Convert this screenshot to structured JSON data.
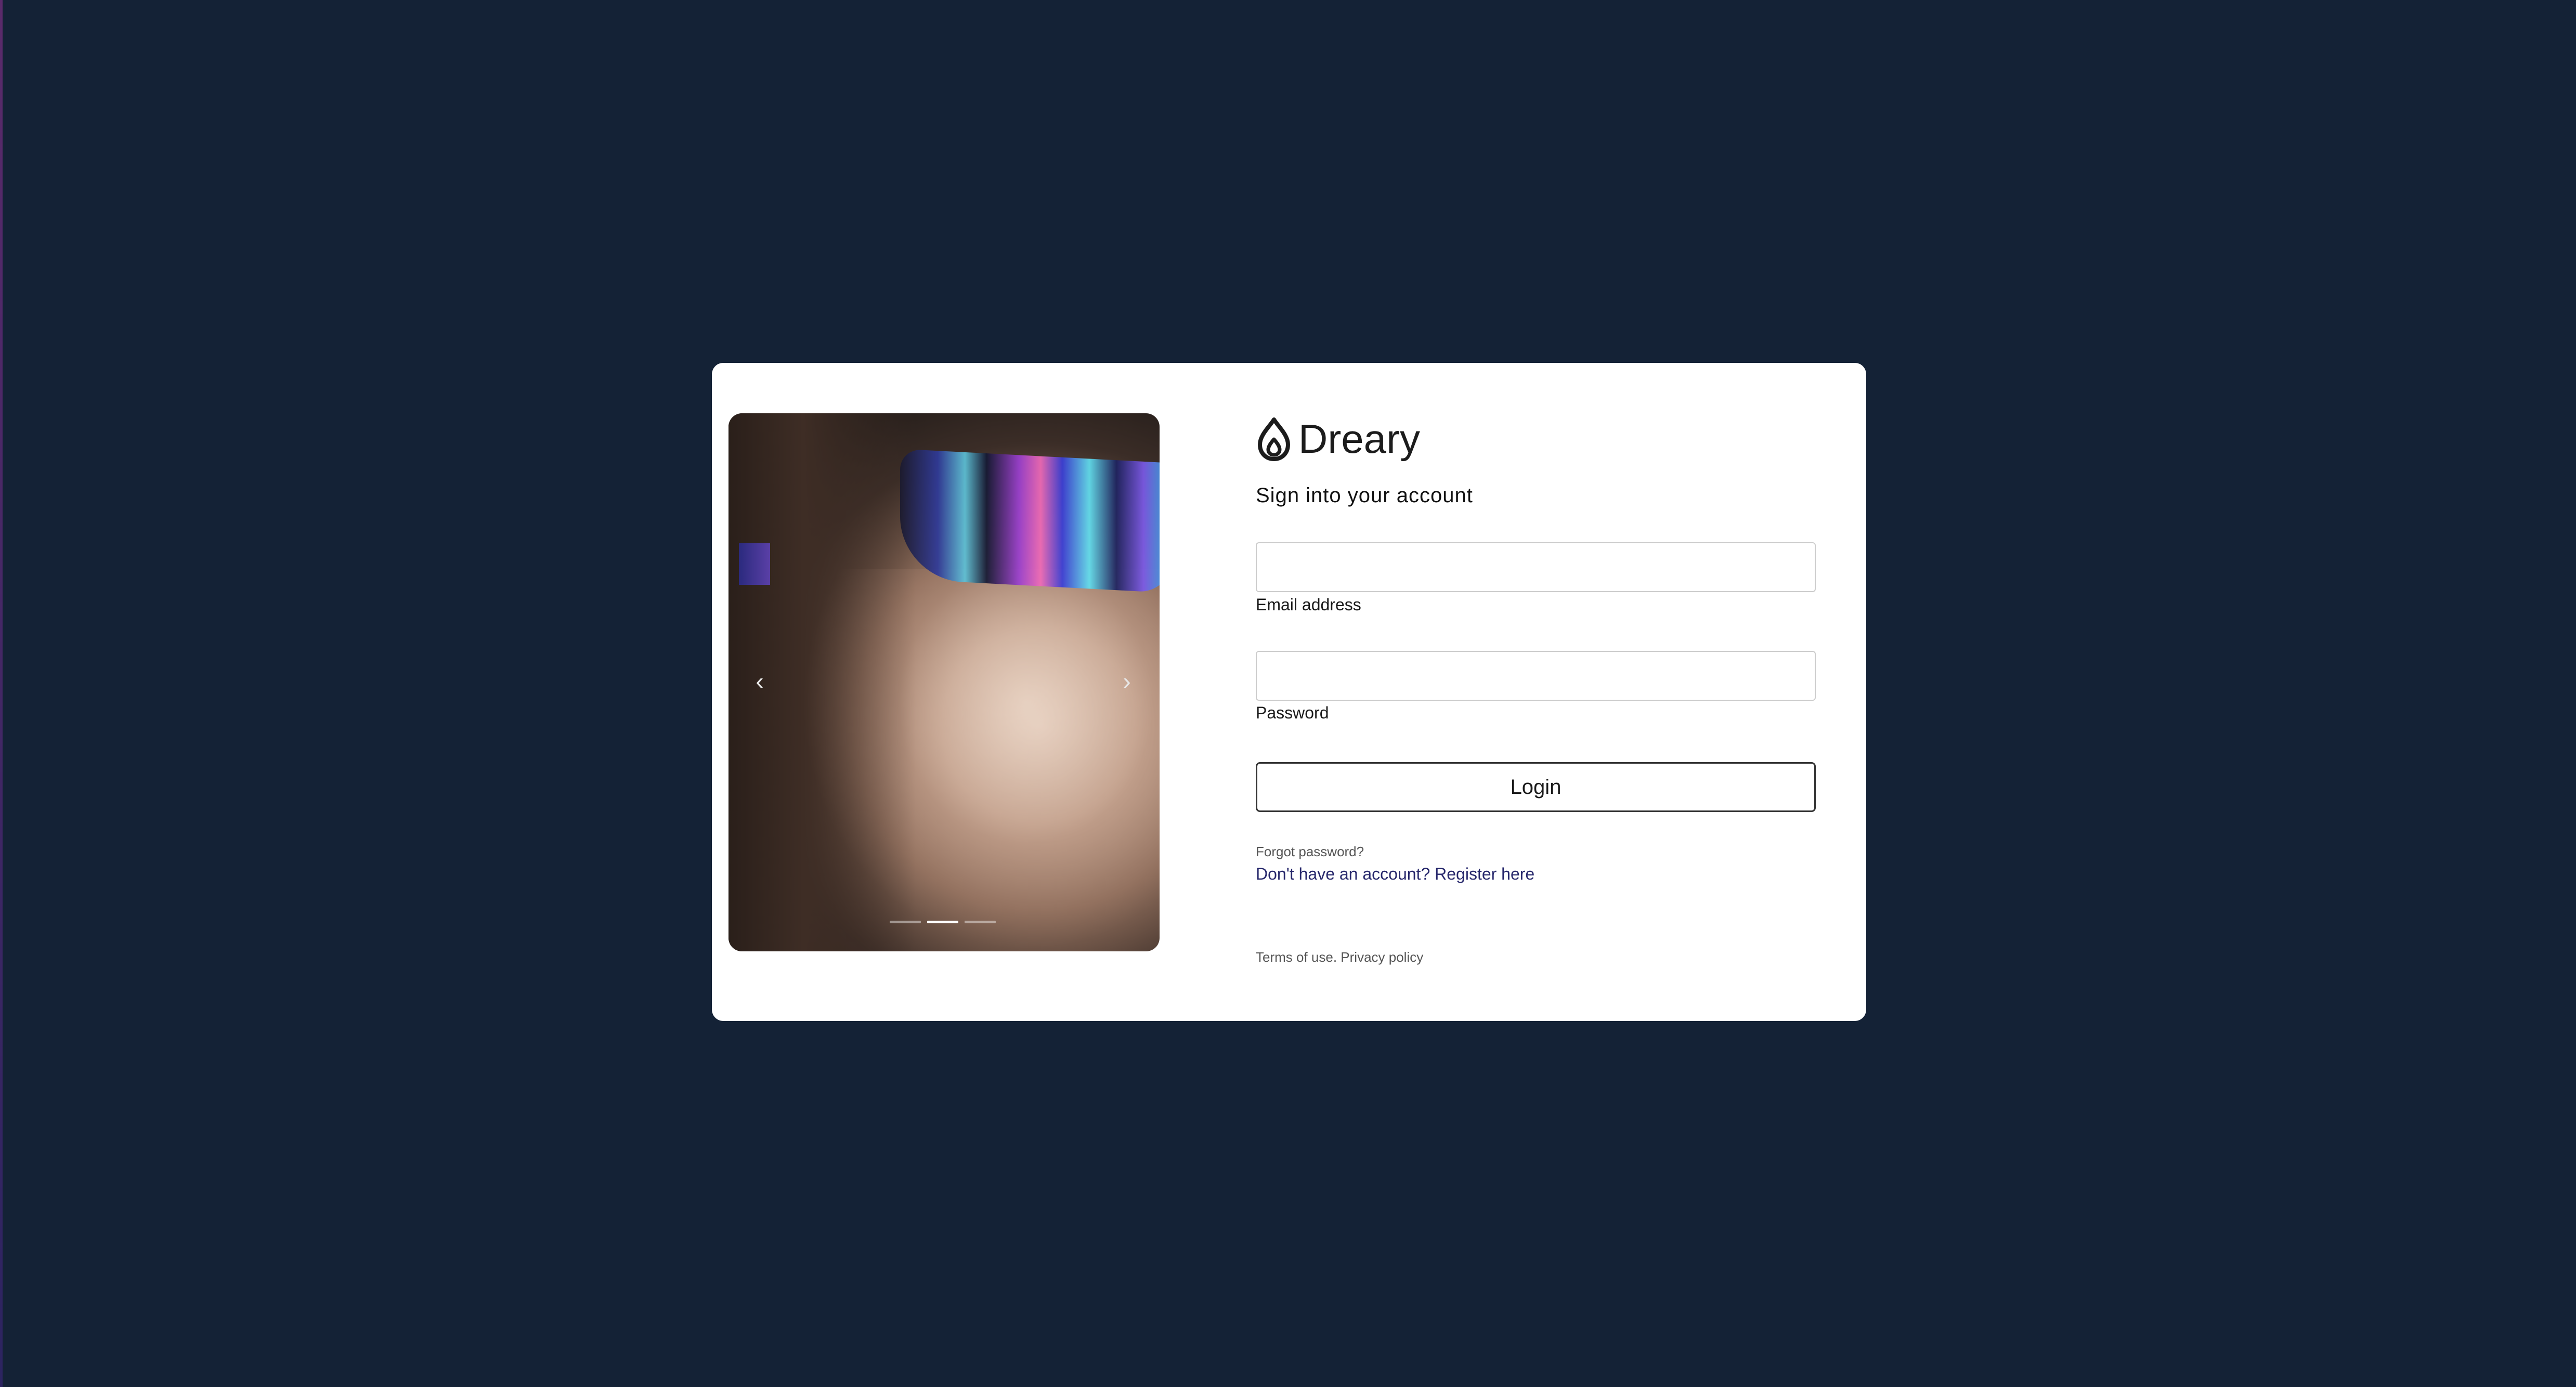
{
  "colors": {
    "page_background": "#142236",
    "card_background": "#ffffff",
    "link_color": "#27286c"
  },
  "carousel": {
    "prev_icon": "chevron-left-icon",
    "next_icon": "chevron-right-icon",
    "prev_glyph": "‹",
    "next_glyph": "›",
    "slide_count": 3,
    "active_slide": 2
  },
  "brand": {
    "logo_icon": "drop-flame-icon",
    "name": "Dreary"
  },
  "form": {
    "heading": "Sign into your account",
    "email": {
      "label": "Email address",
      "value": "",
      "placeholder": ""
    },
    "password": {
      "label": "Password",
      "value": "",
      "placeholder": ""
    },
    "login_label": "Login",
    "forgot_label": "Forgot password?",
    "register_label": "Don't have an account? Register here"
  },
  "footer": {
    "terms_label": "Terms of use.",
    "privacy_label": "Privacy policy"
  }
}
